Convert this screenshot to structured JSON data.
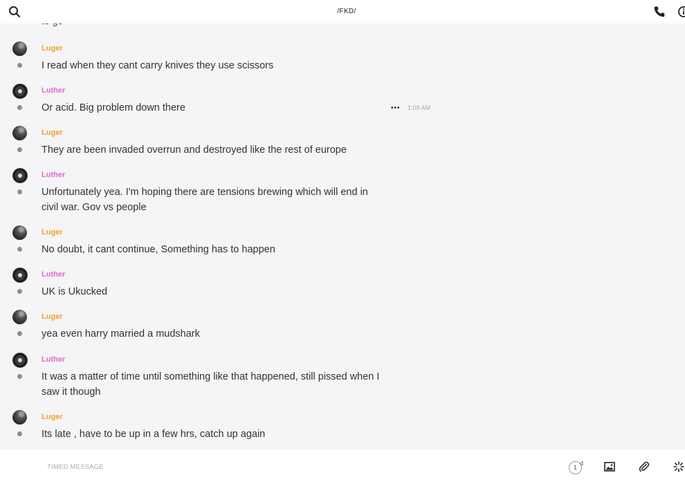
{
  "header": {
    "title": "/FKD/"
  },
  "messages": [
    {
      "author": "Luger",
      "text": "I read when they cant carry knives they use scissors"
    },
    {
      "author": "Luther",
      "text": "Or acid. Big problem down there",
      "time": "1:09 AM"
    },
    {
      "author": "Luger",
      "text": "They are been invaded overrun and destroyed like the rest of europe"
    },
    {
      "author": "Luther",
      "text": "Unfortunately yea. I'm hoping there are tensions brewing which will end in civil war. Gov vs people"
    },
    {
      "author": "Luger",
      "text": "No doubt, it cant continue, Something has to happen"
    },
    {
      "author": "Luther",
      "text": "UK is Ukucked"
    },
    {
      "author": "Luger",
      "text": "yea even harry married a mudshark"
    },
    {
      "author": "Luther",
      "text": "It was a matter of time until something like that happened, still pissed when I saw it though"
    },
    {
      "author": "Luger",
      "text": "Its late , have to be up in a few hrs, catch up again"
    }
  ],
  "footer": {
    "placeholder": "TIMED MESSAGE",
    "timer_value": "1",
    "timer_unit": "d"
  },
  "colors": {
    "luger": "#f0a030",
    "luther": "#e06bc8",
    "background": "#f5f4f6"
  },
  "icons": [
    "search-icon",
    "phone-icon",
    "info-icon",
    "more-icon",
    "image-icon",
    "paperclip-icon",
    "sparkle-icon"
  ]
}
